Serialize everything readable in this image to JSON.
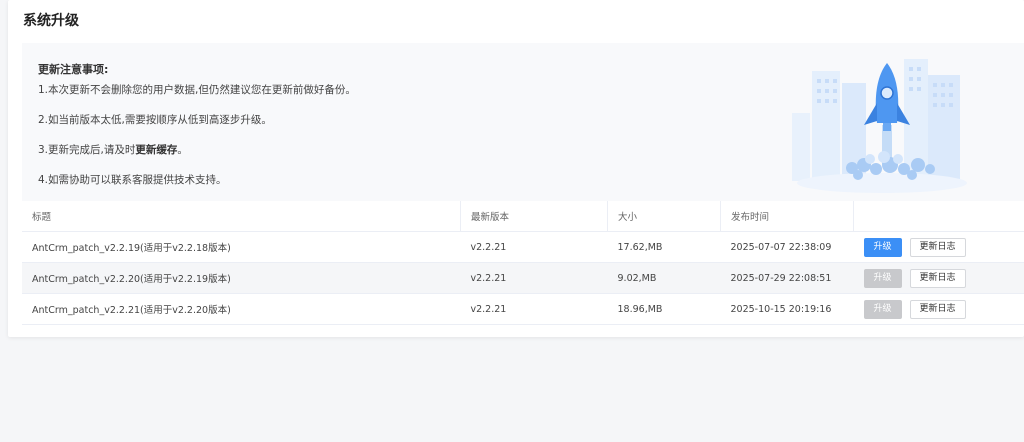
{
  "page": {
    "title": "系统升级"
  },
  "notice": {
    "heading": "更新注意事项:",
    "items": [
      {
        "text": "1.本次更新不会删除您的用户数据,但仍然建议您在更新前做好备份。"
      },
      {
        "text": "2.如当前版本太低,需要按顺序从低到高逐步升级。"
      },
      {
        "pre": "3.更新完成后,请及时",
        "bold": "更新缓存",
        "post": "。"
      },
      {
        "text": "4.如需协助可以联系客服提供技术支持。"
      }
    ]
  },
  "table": {
    "columns": [
      "标题",
      "最新版本",
      "大小",
      "发布时间",
      ""
    ],
    "rows": [
      {
        "title": "AntCrm_patch_v2.2.19(适用于v2.2.18版本)",
        "version": "v2.2.21",
        "size": "17.62,MB",
        "date": "2025-07-07 22:38:09",
        "upgrade": "升级",
        "changelog": "更新日志",
        "upgrade_enabled": true
      },
      {
        "title": "AntCrm_patch_v2.2.20(适用于v2.2.19版本)",
        "version": "v2.2.21",
        "size": "9.02,MB",
        "date": "2025-07-29 22:08:51",
        "upgrade": "升级",
        "changelog": "更新日志",
        "upgrade_enabled": false
      },
      {
        "title": "AntCrm_patch_v2.2.21(适用于v2.2.20版本)",
        "version": "v2.2.21",
        "size": "18.96,MB",
        "date": "2025-10-15 20:19:16",
        "upgrade": "升级",
        "changelog": "更新日志",
        "upgrade_enabled": false
      }
    ]
  },
  "colors": {
    "primary": "#3b8ff6",
    "version_text": "#e6712e",
    "disabled": "#c8c9cc"
  },
  "icons": {
    "illustration": "rocket-launch-illustration"
  }
}
